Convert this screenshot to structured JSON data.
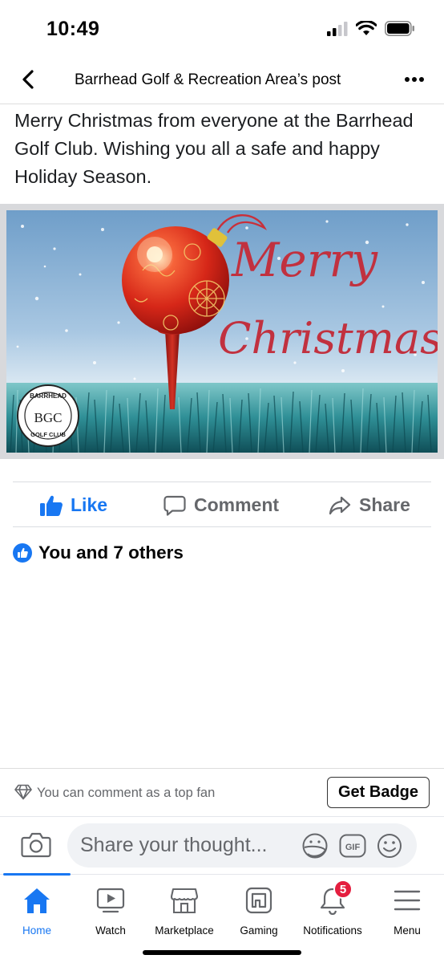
{
  "status_bar": {
    "time": "10:49"
  },
  "header": {
    "title": "Barrhead Golf & Recreation Area’s post"
  },
  "post": {
    "text": "Merry Christmas from everyone at the Barrhead Golf Club. Wishing you all a safe and happy Holiday Season.",
    "image": {
      "greeting_line1": "Merry",
      "greeting_line2": "Christmas",
      "logo_top": "BARRHEAD",
      "logo_center": "BGC",
      "logo_bottom": "GOLF CLUB"
    }
  },
  "actions": {
    "like": "Like",
    "comment": "Comment",
    "share": "Share"
  },
  "reactions": {
    "summary": "You and 7 others"
  },
  "fan_prompt": {
    "text": "You can comment as a top fan",
    "button": "Get Badge"
  },
  "composer": {
    "placeholder": "Share your thought..."
  },
  "tabs": [
    {
      "label": "Home",
      "icon": "home-icon",
      "active": true
    },
    {
      "label": "Watch",
      "icon": "watch-icon"
    },
    {
      "label": "Marketplace",
      "icon": "marketplace-icon"
    },
    {
      "label": "Gaming",
      "icon": "gaming-icon"
    },
    {
      "label": "Notifications",
      "icon": "bell-icon",
      "badge": "5"
    },
    {
      "label": "Menu",
      "icon": "menu-icon"
    }
  ],
  "colors": {
    "accent": "#1877f2",
    "badge": "#e41e3f",
    "script_text": "#c1313f"
  }
}
